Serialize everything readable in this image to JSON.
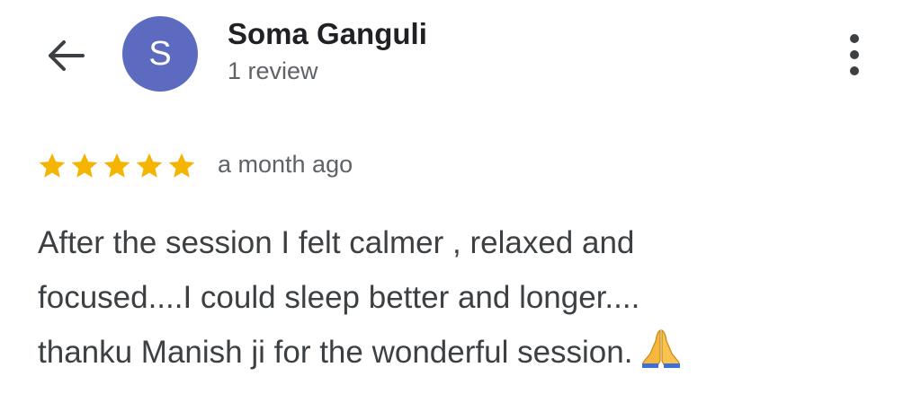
{
  "header": {
    "avatar_letter": "S",
    "avatar_color": "#5c6bc0",
    "reviewer_name": "Soma Ganguli",
    "review_count": "1 review",
    "back_icon": "arrow-back-icon",
    "more_icon": "more-vertical-icon"
  },
  "review": {
    "rating": 5,
    "rating_max": 5,
    "star_color": "#f4b400",
    "date": "a month ago",
    "text_lines": [
      "After the session I felt calmer , relaxed and",
      "focused....I could sleep better and longer....",
      "thanku Manish ji for the wonderful session."
    ],
    "emoji_icon": "folded-hands-icon"
  }
}
